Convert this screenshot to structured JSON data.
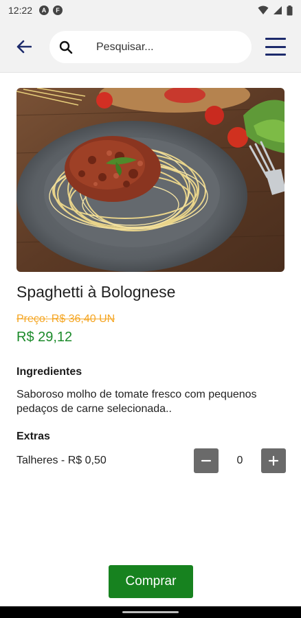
{
  "status_bar": {
    "time": "12:22"
  },
  "search": {
    "placeholder": "Pesquisar..."
  },
  "product": {
    "name": "Spaghetti à Bolognese",
    "old_price": "Preço: R$ 36,40 UN",
    "price": "R$ 29,12",
    "image_description": "Spaghetti à Bolognese"
  },
  "ingredients": {
    "title": "Ingredientes",
    "text": "Saboroso molho de tomate fresco com pequenos pedaços de carne selecionada.."
  },
  "extras": {
    "title": "Extras",
    "items": [
      {
        "label": "Talheres - R$ 0,50",
        "quantity": "0"
      }
    ]
  },
  "buy_button": {
    "label": "Comprar"
  },
  "colors": {
    "accent_navy": "#1c2a6b",
    "price_green": "#1b8a2a",
    "old_price_orange": "#f5a623",
    "buy_green": "#17821f",
    "stepper_gray": "#6a6a6a"
  }
}
